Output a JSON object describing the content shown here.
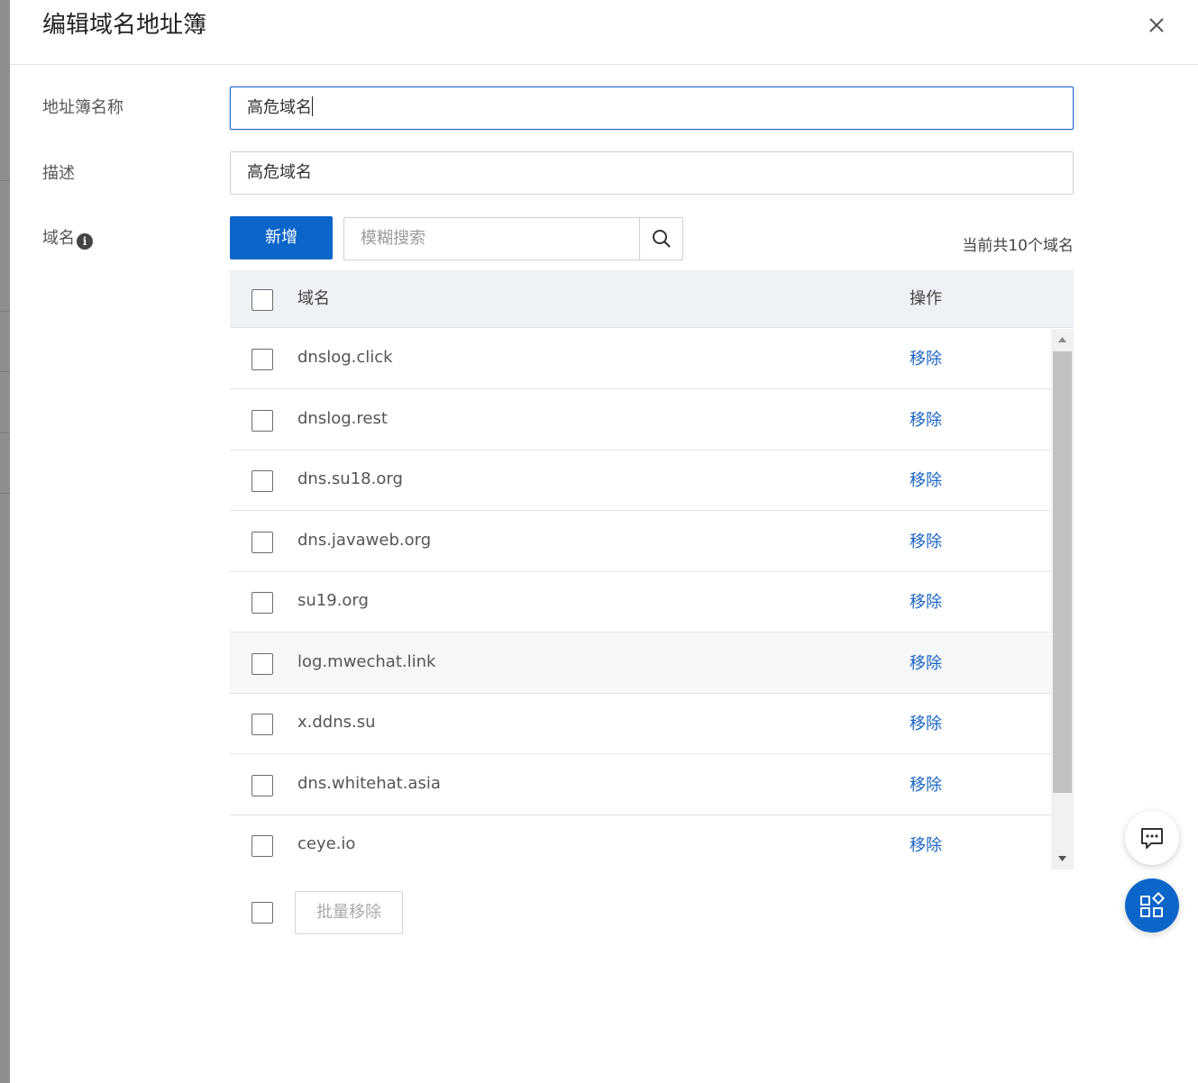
{
  "dialog": {
    "title": "编辑域名地址簿"
  },
  "form": {
    "name_label": "地址簿名称",
    "name_value": "高危域名",
    "desc_label": "描述",
    "desc_value": "高危域名",
    "domain_label": "域名"
  },
  "toolbar": {
    "add_label": "新增",
    "search_placeholder": "模糊搜索",
    "count_text": "当前共10个域名"
  },
  "table": {
    "headers": [
      "域名",
      "操作"
    ],
    "rows": [
      {
        "domain": "dnslog.click",
        "action": "移除"
      },
      {
        "domain": "dnslog.rest",
        "action": "移除"
      },
      {
        "domain": "dns.su18.org",
        "action": "移除"
      },
      {
        "domain": "dns.javaweb.org",
        "action": "移除"
      },
      {
        "domain": "su19.org",
        "action": "移除"
      },
      {
        "domain": "log.mwechat.link",
        "action": "移除"
      },
      {
        "domain": "x.ddns.su",
        "action": "移除"
      },
      {
        "domain": "dns.whitehat.asia",
        "action": "移除"
      },
      {
        "domain": "ceye.io",
        "action": "移除"
      }
    ]
  },
  "footer": {
    "bulk_remove_label": "批量移除"
  },
  "icons": {
    "close": "close-icon",
    "info": "info-icon",
    "search": "search-icon",
    "chat": "chat-icon",
    "apps": "apps-icon"
  },
  "colors": {
    "primary": "#0c65c8",
    "link": "#1a65c7",
    "header_bg": "#eef1f5"
  }
}
